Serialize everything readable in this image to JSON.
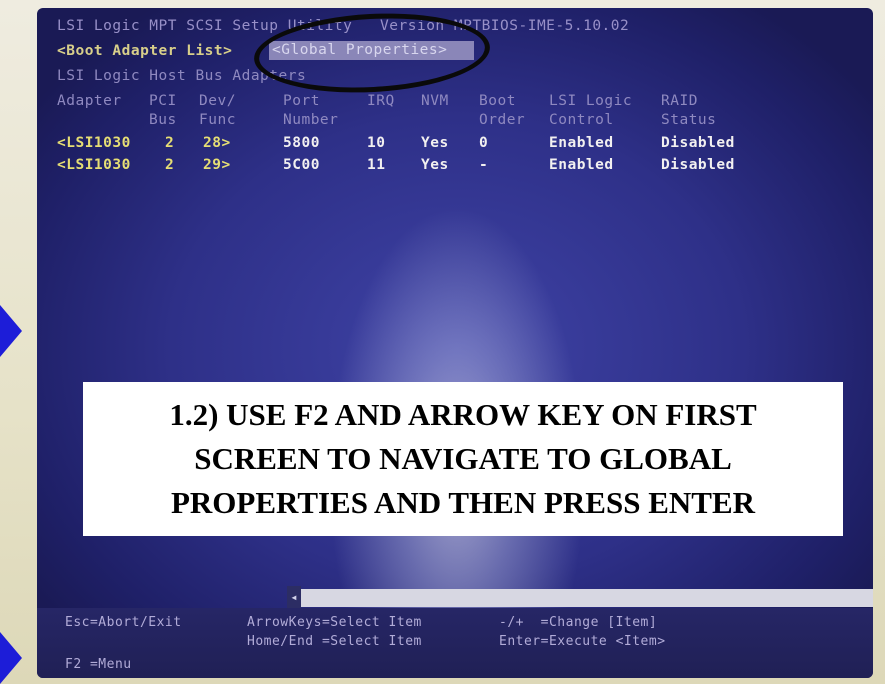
{
  "title_line": "LSI Logic MPT SCSI Setup Utility   Version MPTBIOS-IME-5.10.02",
  "tabs": {
    "boot_adapter": "<Boot Adapter List>",
    "global_properties": "<Global Properties>"
  },
  "table": {
    "group_header": "LSI Logic Host Bus Adapters",
    "headers_row1": [
      "Adapter",
      "PCI",
      "Dev/",
      "Port",
      "IRQ",
      "NVM",
      "Boot",
      "LSI Logic",
      "RAID"
    ],
    "headers_row2": [
      "",
      "Bus",
      "Func",
      "Number",
      "",
      "",
      "Order",
      "Control",
      "Status"
    ],
    "rows": [
      {
        "adapter": "<LSI1030",
        "bus": "2",
        "func": "28>",
        "port": "5800",
        "irq": "10",
        "nvm": "Yes",
        "boot": "0",
        "control": "Enabled",
        "raid": "Disabled"
      },
      {
        "adapter": "<LSI1030",
        "bus": "2",
        "func": "29>",
        "port": "5C00",
        "irq": "11",
        "nvm": "Yes",
        "boot": "-",
        "control": "Enabled",
        "raid": "Disabled"
      }
    ]
  },
  "help": {
    "esc": "Esc=Abort/Exit",
    "arrow": "ArrowKeys=Select Item",
    "change": "-/+  =Change [Item]",
    "home": "Home/End =Select Item",
    "enter": "Enter=Execute <Item>",
    "f2": "F2 =Menu"
  },
  "callout": {
    "line1": "1.2) USE F2 AND ARROW KEY ON FIRST",
    "line2": "SCREEN TO NAVIGATE TO GLOBAL",
    "line3": "PROPERTIES AND THEN PRESS ENTER"
  },
  "colors": {
    "screen_blue": "#2e3088",
    "highlight_white": "#f2f0f0",
    "callout_bg": "#ffffff",
    "arrow_blue": "#1d1dd8"
  }
}
